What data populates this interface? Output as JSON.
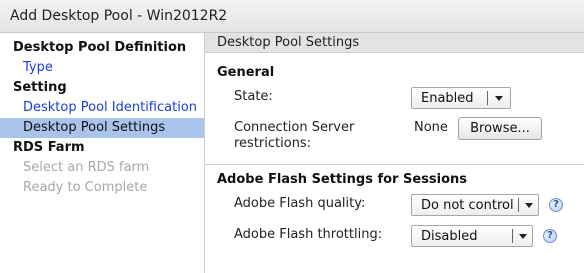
{
  "window": {
    "title": "Add Desktop Pool - Win2012R2"
  },
  "sidebar": {
    "items": [
      {
        "label": "Desktop Pool Definition",
        "kind": "heading"
      },
      {
        "label": "Type",
        "kind": "link"
      },
      {
        "label": "Setting",
        "kind": "heading"
      },
      {
        "label": "Desktop Pool Identification",
        "kind": "link"
      },
      {
        "label": "Desktop Pool Settings",
        "kind": "selected"
      },
      {
        "label": "RDS Farm",
        "kind": "heading"
      },
      {
        "label": "Select an RDS farm",
        "kind": "disabled"
      },
      {
        "label": "Ready to Complete",
        "kind": "disabled"
      }
    ]
  },
  "content": {
    "header": "Desktop Pool Settings",
    "general": {
      "title": "General",
      "state_label": "State:",
      "state_value": "Enabled",
      "conn_label_line1": "Connection Server",
      "conn_label_line2": "restrictions:",
      "conn_value": "None",
      "browse_label": "Browse..."
    },
    "flash": {
      "title": "Adobe Flash Settings for Sessions",
      "quality_label": "Adobe Flash quality:",
      "quality_value": "Do not control",
      "throttling_label": "Adobe Flash throttling:",
      "throttling_value": "Disabled",
      "help_glyph": "?"
    }
  },
  "colors": {
    "selected_bg": "#a9c3ea",
    "link": "#1b3fd6",
    "disabled": "#a8a8a8",
    "header_bg": "#e3e3e3"
  },
  "icons": [
    "chevron-down-icon",
    "help-icon"
  ]
}
